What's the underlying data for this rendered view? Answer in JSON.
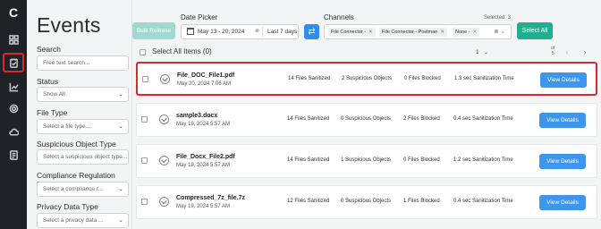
{
  "nav": {
    "logo": "C",
    "items": [
      {
        "icon": "grid-icon"
      },
      {
        "icon": "events-icon",
        "active": true
      },
      {
        "icon": "chart-icon"
      },
      {
        "icon": "settings-icon"
      },
      {
        "icon": "cloud-icon"
      },
      {
        "icon": "document-icon"
      }
    ]
  },
  "page": {
    "title": "Events"
  },
  "filters": {
    "search": {
      "label": "Search",
      "placeholder": "Free text search..."
    },
    "status": {
      "label": "Status",
      "value": "Show All"
    },
    "file_type": {
      "label": "File Type",
      "value": "Select a file type..."
    },
    "suspicious": {
      "label": "Suspicious Object Type",
      "value": "Select a suspicious object type..."
    },
    "compliance": {
      "label": "Compliance Regulation Rule",
      "value": "Select a compliance r..."
    },
    "privacy": {
      "label": "Privacy Data Type",
      "value": "Select a privacy data ..."
    }
  },
  "toolbar": {
    "bulk_release": "Bulk Release",
    "date_picker_label": "Date Picker",
    "date_range": "May 13 - 20, 2024",
    "date_preset": "Last 7 days",
    "channels_label": "Channels",
    "channels": [
      "File Connector -",
      "File Connector - Postman",
      "None -"
    ],
    "selected_count": "Selected: 3",
    "select_all": "Select All"
  },
  "list": {
    "select_all_items": "Select All Items (0)",
    "page_number": "1",
    "pager_of": "of",
    "pager_total": "5",
    "view_details": "View Details",
    "rows": [
      {
        "name": "File_DOC_File1.pdf",
        "date": "May 20, 2024 7:06 AM",
        "sanitized": "14 Files Sanitized",
        "suspicious": "2 Suspicious Objects",
        "blocked": "0 Files Blocked",
        "time": "1.3 sec Sanitization Time"
      },
      {
        "name": "sample3.docx",
        "date": "May 19, 2024 5:57 AM",
        "sanitized": "14 Files Sanitized",
        "suspicious": "0 Suspicious Objects",
        "blocked": "2 Files Blocked",
        "time": "0.4 sec Sanitization Time"
      },
      {
        "name": "File_Docx_File2.pdf",
        "date": "May 19, 2024 5:57 AM",
        "sanitized": "14 Files Sanitized",
        "suspicious": "1 Suspicious Objects",
        "blocked": "0 Files Blocked",
        "time": "1.2 sec Sanitization Time"
      },
      {
        "name": "Compressed_7z_file.7z",
        "date": "May 19, 2024 5:57 AM",
        "sanitized": "12 Files Sanitized",
        "suspicious": "0 Suspicious Objects",
        "blocked": "1 Files Blocked",
        "time": "0.4 sec Sanitization Time"
      }
    ]
  }
}
